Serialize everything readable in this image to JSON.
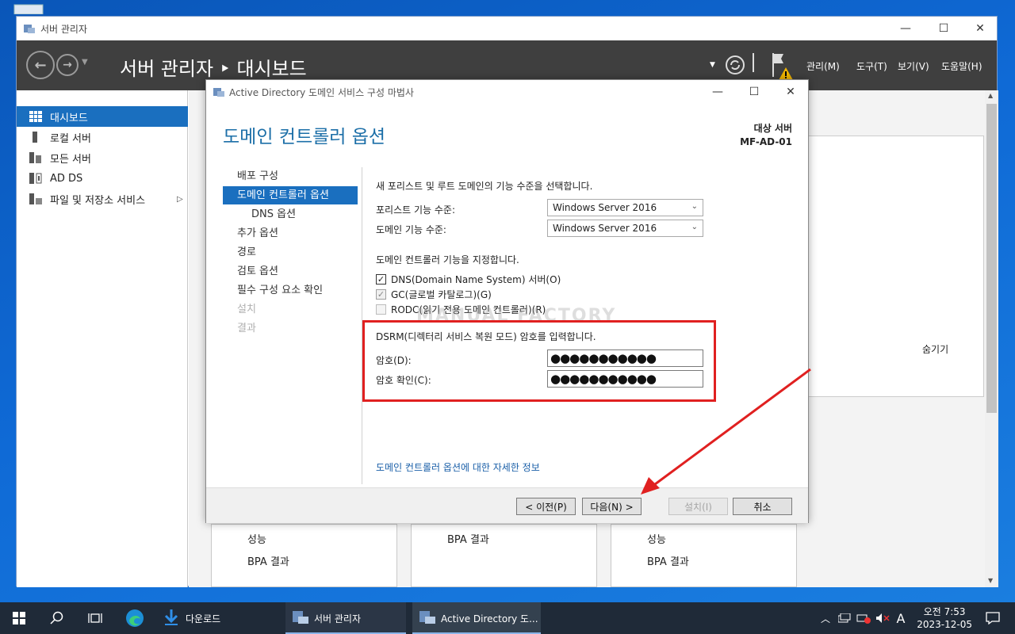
{
  "server_manager": {
    "window_title": "서버 관리자",
    "breadcrumb": "서버 관리자 ‣ 대시보드",
    "menus": [
      "관리(M)",
      "도구(T)",
      "보기(V)",
      "도움말(H)"
    ],
    "sidebar": [
      {
        "label": "대시보드",
        "icon": "dashboard-icon"
      },
      {
        "label": "로컬 서버",
        "icon": "server-icon"
      },
      {
        "label": "모든 서버",
        "icon": "servers-icon"
      },
      {
        "label": "AD DS",
        "icon": "ad-ds-icon"
      },
      {
        "label": "파일 및 저장소 서비스",
        "icon": "storage-icon"
      }
    ],
    "hide_label": "숨기기",
    "tiles": [
      {
        "lines": [
          "성능",
          "BPA 결과"
        ]
      },
      {
        "lines": [
          "BPA 결과"
        ]
      },
      {
        "lines": [
          "성능",
          "BPA 결과"
        ]
      }
    ]
  },
  "wizard": {
    "window_title": "Active Directory 도메인 서비스 구성 마법사",
    "heading": "도메인 컨트롤러 옵션",
    "target_label": "대상 서버",
    "target_server": "MF-AD-01",
    "nav": [
      {
        "label": "배포 구성",
        "state": "normal"
      },
      {
        "label": "도메인 컨트롤러 옵션",
        "state": "active"
      },
      {
        "label": "DNS 옵션",
        "state": "sub"
      },
      {
        "label": "추가 옵션",
        "state": "normal"
      },
      {
        "label": "경로",
        "state": "normal"
      },
      {
        "label": "검토 옵션",
        "state": "normal"
      },
      {
        "label": "필수 구성 요소 확인",
        "state": "normal"
      },
      {
        "label": "설치",
        "state": "disabled"
      },
      {
        "label": "결과",
        "state": "disabled"
      }
    ],
    "func_level_intro": "새 포리스트 및 루트 도메인의 기능 수준을 선택합니다.",
    "forest_level_label": "포리스트 기능 수준:",
    "forest_level_value": "Windows Server 2016",
    "domain_level_label": "도메인 기능 수준:",
    "domain_level_value": "Windows Server 2016",
    "dc_caps_intro": "도메인 컨트롤러 기능을 지정합니다.",
    "checkboxes": [
      {
        "label": "DNS(Domain Name System) 서버(O)",
        "checked": true,
        "enabled": true
      },
      {
        "label": "GC(글로벌 카탈로그)(G)",
        "checked": true,
        "enabled": false
      },
      {
        "label": "RODC(읽기 전용 도메인 컨트롤러)(R)",
        "checked": false,
        "enabled": false
      }
    ],
    "dsrm_intro": "DSRM(디렉터리 서비스 복원 모드) 암호를 입력합니다.",
    "password_label": "암호(D):",
    "password_value": "●●●●●●●●●●●",
    "confirm_label": "암호 확인(C):",
    "confirm_value": "●●●●●●●●●●●",
    "watermark": "MANUAL FACTORY",
    "more_info_link": "도메인 컨트롤러 옵션에 대한 자세한 정보",
    "buttons": {
      "prev": "< 이전(P)",
      "next": "다음(N) >",
      "install": "설치(I)",
      "cancel": "취소"
    }
  },
  "taskbar": {
    "apps": [
      {
        "label": "다운로드",
        "icon": "download-icon"
      },
      {
        "label": "서버 관리자",
        "icon": "server-manager-icon"
      },
      {
        "label": "Active Directory 도...",
        "icon": "ad-wizard-icon"
      }
    ],
    "ime": "A",
    "time": "오전 7:53",
    "date": "2023-12-05"
  },
  "colors": {
    "accent": "#1a6fbf",
    "heading": "#1c6fa8",
    "highlight_red": "#e02020",
    "header_dark": "#3f3f3f"
  }
}
